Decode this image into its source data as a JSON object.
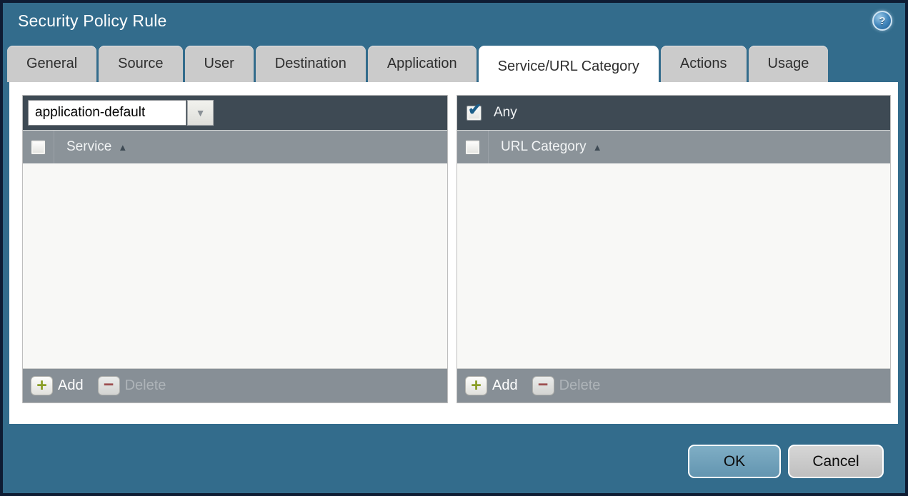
{
  "window": {
    "title": "Security Policy Rule"
  },
  "tabs": [
    {
      "label": "General",
      "active": false
    },
    {
      "label": "Source",
      "active": false
    },
    {
      "label": "User",
      "active": false
    },
    {
      "label": "Destination",
      "active": false
    },
    {
      "label": "Application",
      "active": false
    },
    {
      "label": "Service/URL Category",
      "active": true
    },
    {
      "label": "Actions",
      "active": false
    },
    {
      "label": "Usage",
      "active": false
    }
  ],
  "service_panel": {
    "dropdown_value": "application-default",
    "column_header": "Service",
    "header_checkbox_checked": false,
    "rows": [],
    "add_label": "Add",
    "delete_label": "Delete",
    "delete_enabled": false
  },
  "url_category_panel": {
    "any_label": "Any",
    "any_checked": true,
    "column_header": "URL Category",
    "header_checkbox_checked": false,
    "rows": [],
    "add_label": "Add",
    "delete_label": "Delete",
    "delete_enabled": false
  },
  "footer": {
    "ok_label": "OK",
    "cancel_label": "Cancel"
  },
  "icons": {
    "help": "?",
    "dropdown_arrow": "▼",
    "sort_asc": "▲",
    "check": "✔",
    "add_glyph": "+",
    "delete_glyph": "−"
  },
  "colors": {
    "dialog_background": "#336C8C",
    "outer_border": "#0E1C33",
    "panel_header": "#3E4A54",
    "column_header": "#8B9399",
    "panel_footer": "#878F96",
    "active_tab": "#FFFFFF",
    "inactive_tab": "#CBCBCB",
    "ok_button": "#6FA2BB",
    "cancel_button": "#CCCCCC",
    "add_icon_green": "#8A9E26",
    "delete_icon_red": "#A04343",
    "checkbox_check_blue": "#1D5F8A"
  }
}
